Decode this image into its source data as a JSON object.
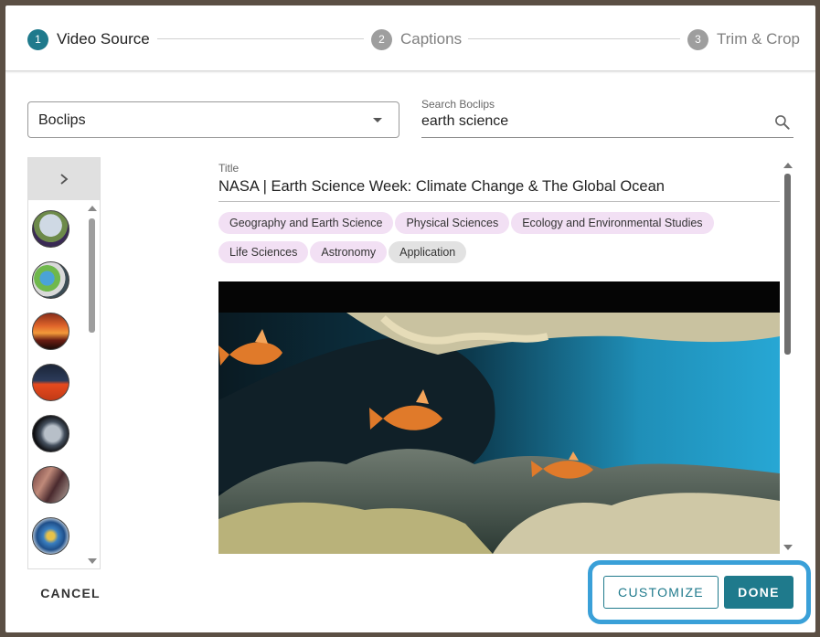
{
  "stepper": {
    "steps": [
      {
        "number": "1",
        "label": "Video Source",
        "state": "active"
      },
      {
        "number": "2",
        "label": "Captions",
        "state": "inactive"
      },
      {
        "number": "3",
        "label": "Trim & Crop",
        "state": "inactive"
      }
    ]
  },
  "source": {
    "selected": "Boclips"
  },
  "search": {
    "label": "Search Boclips",
    "value": "earth science",
    "icon": "search-icon"
  },
  "list": {
    "expand_icon": "chevron-right-icon"
  },
  "detail": {
    "title_label": "Title",
    "title": "NASA | Earth Science Week: Climate Change & The Global Ocean",
    "tags_row1": [
      "Geography and Earth Science",
      "Physical Sciences",
      "Ecology and Environmental Studies"
    ],
    "tags_row2": [
      "Life Sciences",
      "Astronomy"
    ],
    "grey_tag": "Application"
  },
  "footer": {
    "cancel": "CANCEL",
    "customize": "CUSTOMIZE",
    "done": "DONE"
  },
  "colors": {
    "accent": "#1f7a8c",
    "highlight": "#3aa0d8",
    "tag_bg": "#f2e0f4"
  }
}
